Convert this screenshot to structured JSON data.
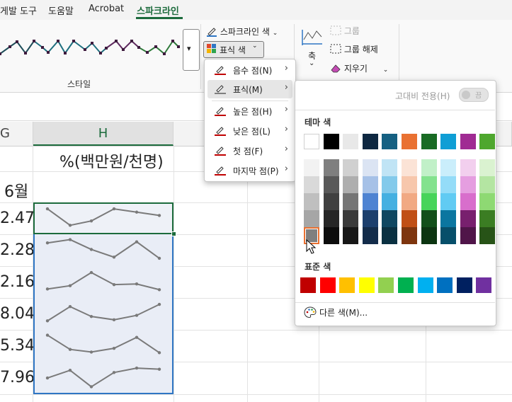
{
  "ribbon_tabs": {
    "tab1": "게발 도구",
    "tab2": "도움말",
    "tab3": "Acrobat",
    "active": "스파크라인"
  },
  "ribbon": {
    "sparkline_color_label": "스파크라인 색",
    "marker_color_label": "표식 색",
    "styles_label": "스타일",
    "axis_label": "축",
    "group_label": "그룹",
    "ungroup_label": "그룹 해제",
    "clear_label": "지우기",
    "style_colors": [
      "#1f4e5a",
      "#1e6f7f",
      "#1e6f7f",
      "#5f2a5f",
      "#2e7a3a",
      "#2e7a3a"
    ]
  },
  "grid": {
    "col_g": "G",
    "col_h": "H",
    "h_header_value": "%(백만원/천명)",
    "month_label": "6월",
    "g_values": [
      "2.47",
      "2.28",
      "2.16",
      "8.04",
      "5.34",
      "7.96"
    ],
    "sparkline_color": "#7a7a7a",
    "sparklines": [
      [
        0.9,
        0.15,
        0.35,
        0.9,
        0.75,
        0.6
      ],
      [
        0.8,
        0.95,
        0.5,
        0.15,
        0.85,
        0.1
      ],
      [
        0.15,
        0.3,
        0.9,
        0.35,
        0.38,
        0.12
      ],
      [
        0.15,
        0.8,
        0.35,
        0.2,
        0.4,
        0.9
      ],
      [
        0.95,
        0.3,
        0.18,
        0.35,
        0.85,
        0.15
      ],
      [
        0.45,
        0.8,
        0.05,
        0.7,
        0.9,
        0.85
      ]
    ]
  },
  "marker_menu": {
    "items": [
      {
        "label": "음수 점(N)",
        "icon": "marker-color-icon"
      },
      {
        "label": "표식(M)",
        "icon": "marker-color-icon"
      },
      {
        "label": "높은 점(H)",
        "icon": "marker-color-icon"
      },
      {
        "label": "낮은 점(L)",
        "icon": "marker-color-icon"
      },
      {
        "label": "첫 점(F)",
        "icon": "marker-color-icon"
      },
      {
        "label": "마지막 점(P)",
        "icon": "marker-color-icon"
      }
    ]
  },
  "palette": {
    "high_contrast_label": "고대비 전용(H)",
    "toggle_text": "끔",
    "theme_label": "테마 색",
    "standard_label": "표준 색",
    "more_colors_label": "다른 색(M)...",
    "theme_top": [
      "#ffffff",
      "#000000",
      "#e8e8e8",
      "#0e2841",
      "#156082",
      "#e97132",
      "#196b24",
      "#0f9ed5",
      "#a02b93",
      "#4ea72e"
    ],
    "theme_shades": [
      [
        "#f2f2f2",
        "#7f7f7f",
        "#d0d0d0",
        "#dbe4f3",
        "#c0e4f5",
        "#fbe3d6",
        "#c1f0c8",
        "#caeefb",
        "#f2cfee",
        "#daf2d0"
      ],
      [
        "#d9d9d9",
        "#595959",
        "#aeaeae",
        "#a6c1e7",
        "#83caeb",
        "#f7c7ac",
        "#83e28e",
        "#94dcf8",
        "#e59ee0",
        "#b4e5a2"
      ],
      [
        "#bfbfbf",
        "#404040",
        "#757575",
        "#4e83d2",
        "#45b0e1",
        "#f1a983",
        "#47d45a",
        "#61cbf3",
        "#d86ecc",
        "#8ed973"
      ],
      [
        "#a6a6a6",
        "#262626",
        "#3a3a3a",
        "#1c3f6d",
        "#0f4761",
        "#c04f15",
        "#124f1a",
        "#0b76a0",
        "#78206e",
        "#3b7d23"
      ],
      [
        "#7f7f7f",
        "#0d0d0d",
        "#171717",
        "#132c4a",
        "#0a3041",
        "#7e350e",
        "#0c3511",
        "#074f6a",
        "#501549",
        "#275317"
      ]
    ],
    "standard": [
      "#c00000",
      "#ff0000",
      "#ffc000",
      "#ffff00",
      "#92d050",
      "#00b050",
      "#00b0f0",
      "#0070c0",
      "#002060",
      "#7030a0"
    ]
  }
}
